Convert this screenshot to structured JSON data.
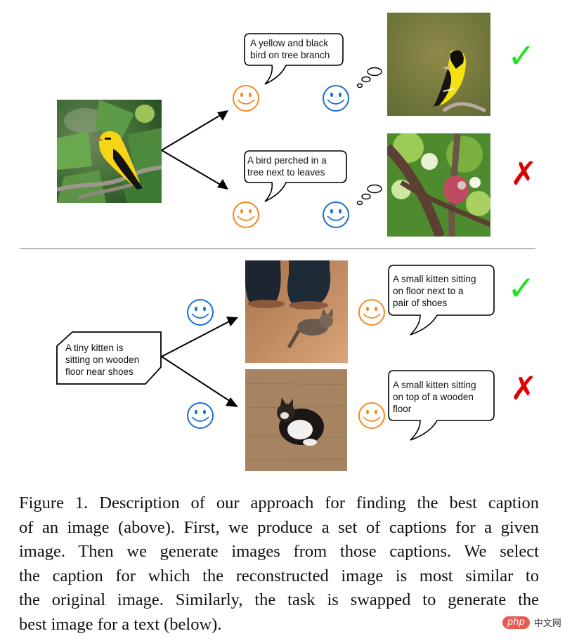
{
  "figure": {
    "top_panel": {
      "input_image_alt": "yellow and black bird on a fig tree branch",
      "candidates": [
        {
          "caption": [
            "A yellow and black",
            "bird on tree branch"
          ],
          "generated_image_alt": "generated yellow and black bird on branch",
          "verdict": "correct",
          "verdict_symbol": "✓"
        },
        {
          "caption": [
            "A bird perched in a",
            "tree next to leaves"
          ],
          "generated_image_alt": "generated pink bird in tree",
          "verdict": "incorrect",
          "verdict_symbol": "✗"
        }
      ]
    },
    "bottom_panel": {
      "input_text": [
        "A tiny kitten is",
        "sitting on wooden",
        "floor near shoes"
      ],
      "candidates": [
        {
          "generated_image_alt": "kitten on wooden floor next to shoes",
          "caption": [
            "A small kitten sitting",
            "on floor next to a",
            "pair of shoes"
          ],
          "verdict": "correct",
          "verdict_symbol": "✓"
        },
        {
          "generated_image_alt": "kitten curled on wooden floor",
          "caption": [
            "A small kitten sitting",
            "on top of a wooden",
            "floor"
          ],
          "verdict": "incorrect",
          "verdict_symbol": "✗"
        }
      ]
    },
    "caption_lines": [
      "Figure 1. Description of our approach for finding the best caption",
      "of an image (above). First, we produce a set of captions for a given",
      "image. Then we generate images from those captions. We select",
      "the caption for which the reconstructed image is most similar to",
      "the original image. Similarly, the task is swapped to generate the",
      "best image for a text (below)."
    ]
  },
  "colors": {
    "orange_face": "#f5891f",
    "blue_face": "#1a6fd1",
    "check_green": "#1ee31e",
    "cross_red": "#e00000"
  },
  "watermark": {
    "logo": "php",
    "text": "中文网"
  }
}
